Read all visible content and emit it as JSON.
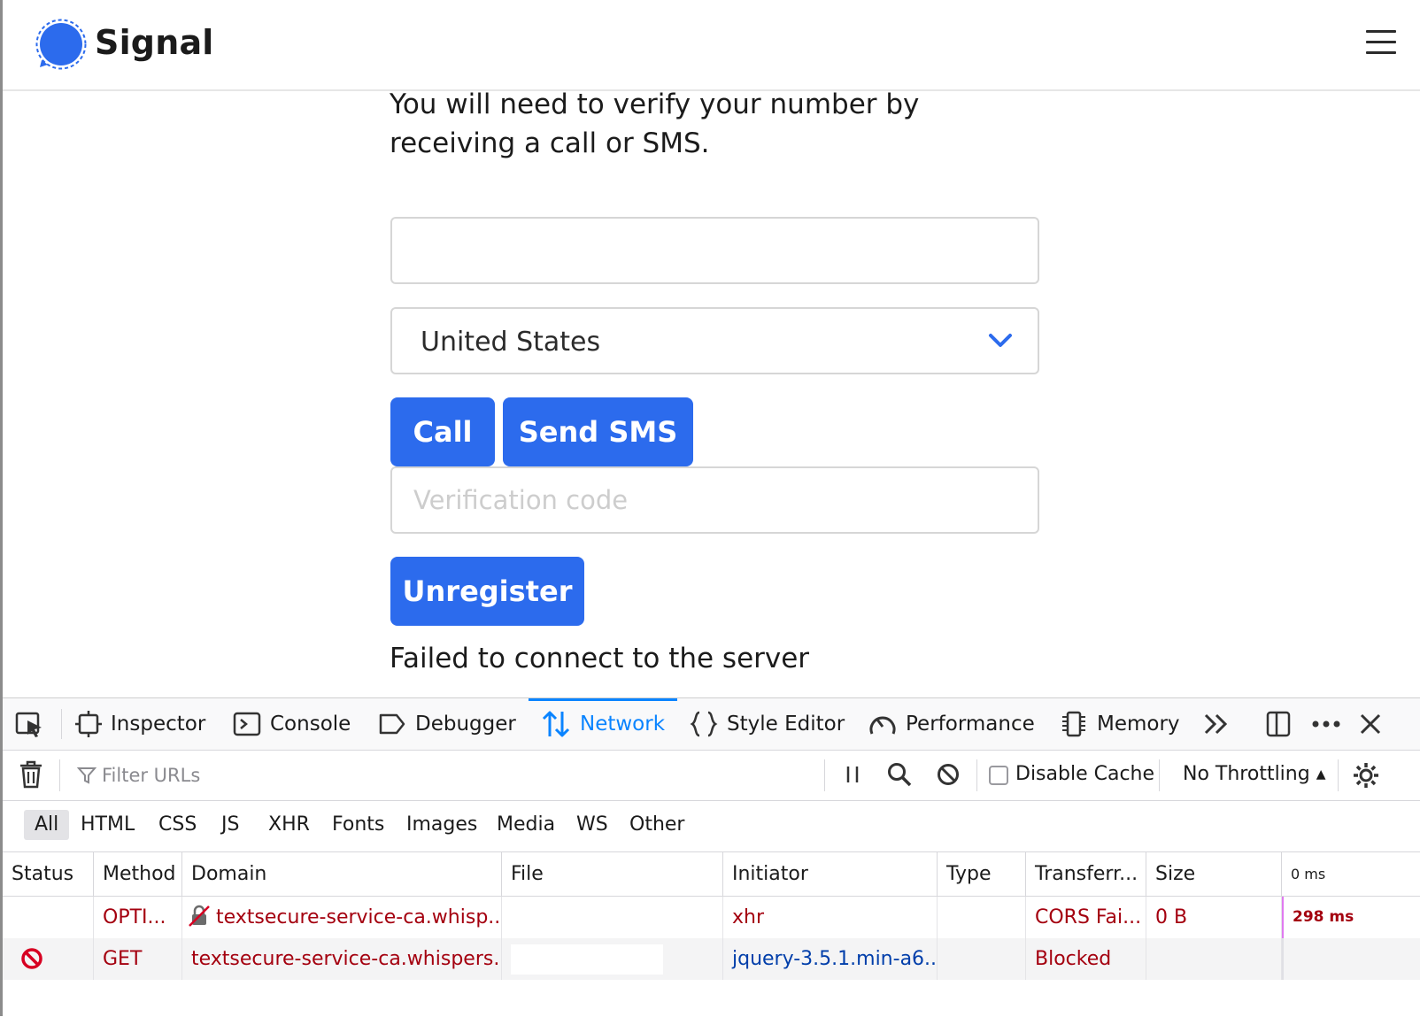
{
  "header": {
    "brand": "Signal",
    "menu_icon": "hamburger-menu-icon",
    "accent": "#2c6bed"
  },
  "form": {
    "intro": "You will need to verify your number by receiving a call or SMS.",
    "phone_value": "",
    "country_value": "United States",
    "call_label": "Call",
    "sms_label": "Send SMS",
    "code_placeholder": "Verification code",
    "unregister_label": "Unregister",
    "status_text": "Failed to connect to the server"
  },
  "devtools": {
    "tabs": [
      {
        "label": "Inspector"
      },
      {
        "label": "Console"
      },
      {
        "label": "Debugger"
      },
      {
        "label": "Network"
      },
      {
        "label": "Style Editor"
      },
      {
        "label": "Performance"
      },
      {
        "label": "Memory"
      }
    ],
    "active_tab": "Network",
    "filter_placeholder": "Filter URLs",
    "disable_cache_label": "Disable Cache",
    "throttling_label": "No Throttling",
    "type_filters": [
      "All",
      "HTML",
      "CSS",
      "JS",
      "XHR",
      "Fonts",
      "Images",
      "Media",
      "WS",
      "Other"
    ],
    "columns": [
      "Status",
      "Method",
      "Domain",
      "File",
      "Initiator",
      "Type",
      "Transferr...",
      "Size",
      "0 ms"
    ],
    "rows": [
      {
        "status": "",
        "method": "OPTI...",
        "domain": "textsecure-service-ca.whisp...",
        "file": "",
        "initiator": "xhr",
        "type": "",
        "transferred": "CORS Fai...",
        "size": "0 B",
        "timing": "298 ms"
      },
      {
        "status": "blocked-icon",
        "method": "GET",
        "domain": "textsecure-service-ca.whispers...",
        "file": "",
        "initiator": "jquery-3.5.1.min-a6...",
        "type": "",
        "transferred": "Blocked",
        "size": "",
        "timing": ""
      }
    ],
    "error_color": "#a4000f",
    "link_color": "#003eaa",
    "active_color": "#0a84ff"
  }
}
